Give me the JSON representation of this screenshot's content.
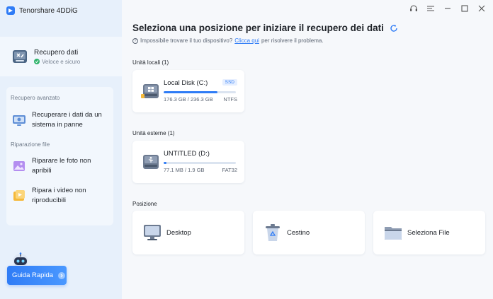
{
  "app": {
    "title": "Tenorshare 4DDiG"
  },
  "sidebar": {
    "main_item": {
      "label": "Recupero dati",
      "sub": "Veloce e sicuro"
    },
    "advanced_heading": "Recupero avanzato",
    "advanced_items": [
      {
        "label": "Recuperare i dati da un sistema in panne"
      }
    ],
    "repair_heading": "Riparazione file",
    "repair_items": [
      {
        "label": "Riparare le foto non apribili"
      },
      {
        "label": "Ripara i video non riproducibili"
      }
    ],
    "guide_button": "Guida Rapida"
  },
  "main": {
    "title": "Seleziona una posizione per iniziare il recupero dei dati",
    "help_prefix": "Impossibile trovare il tuo dispositivo?",
    "help_link": "Clicca qui",
    "help_suffix": "per risolvere il problema.",
    "local_label": "Unità locali (1)",
    "external_label": "Unità esterne (1)",
    "position_label": "Posizione",
    "local_drives": [
      {
        "name": "Local Disk (C:)",
        "badge": "SSD",
        "size": "176.3 GB / 236.3 GB",
        "fs": "NTFS",
        "used_fraction": 0.746
      }
    ],
    "external_drives": [
      {
        "name": "UNTITLED (D:)",
        "size": "77.1 MB / 1.9 GB",
        "fs": "FAT32",
        "used_fraction": 0.04
      }
    ],
    "locations": [
      {
        "label": "Desktop",
        "icon": "desktop-icon"
      },
      {
        "label": "Cestino",
        "icon": "recycle-bin-icon"
      },
      {
        "label": "Seleziona File",
        "icon": "folder-icon"
      }
    ]
  },
  "colors": {
    "accent": "#2f7cf6",
    "sidebar_bg": "#e7f0fb",
    "main_bg": "#f6f8fb",
    "success": "#2fb36b"
  }
}
